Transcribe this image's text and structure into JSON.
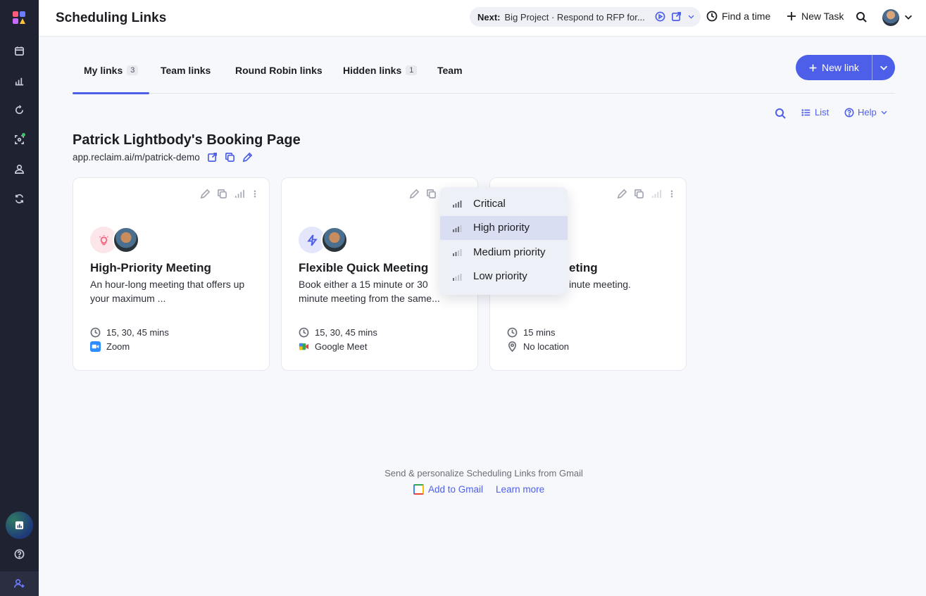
{
  "header": {
    "title": "Scheduling Links",
    "next_label": "Next:",
    "next_text": "Big Project · Respond to RFP for...",
    "find_time": "Find a time",
    "new_task": "New Task"
  },
  "tabs": [
    {
      "label": "My links",
      "count": "3"
    },
    {
      "label": "Team links"
    },
    {
      "label": "Round Robin links"
    },
    {
      "label": "Hidden links",
      "count": "1"
    },
    {
      "label": "Team"
    }
  ],
  "new_link_label": "New link",
  "toolbar": {
    "view_label": "List",
    "help_label": "Help"
  },
  "booking": {
    "title": "Patrick Lightbody's Booking Page",
    "url": "app.reclaim.ai/m/patrick-demo"
  },
  "cards": [
    {
      "title": "High-Priority Meeting",
      "description": "An hour-long meeting that offers up your maximum ...",
      "durations": "15, 30, 45 mins",
      "location": "Zoom",
      "type_icon": "lightbulb-icon"
    },
    {
      "title": "Flexible Quick Meeting",
      "description": "Book either a 15 minute or 30 minute meeting from the same...",
      "durations": "15, 30, 45 mins",
      "location": "Google Meet",
      "type_icon": "lightning-icon"
    },
    {
      "title": "eting",
      "description": "inute meeting.",
      "durations": "15 mins",
      "location": "No location",
      "type_icon": "none"
    }
  ],
  "priority_menu": {
    "items": [
      "Critical",
      "High priority",
      "Medium priority",
      "Low priority"
    ],
    "selected": "High priority"
  },
  "gmail": {
    "promo": "Send & personalize Scheduling Links from Gmail",
    "add_label": "Add to Gmail",
    "learn_label": "Learn more"
  },
  "colors": {
    "accent": "#4d5fe8",
    "sidebar": "#1f2230",
    "background": "#f7f8fc"
  }
}
